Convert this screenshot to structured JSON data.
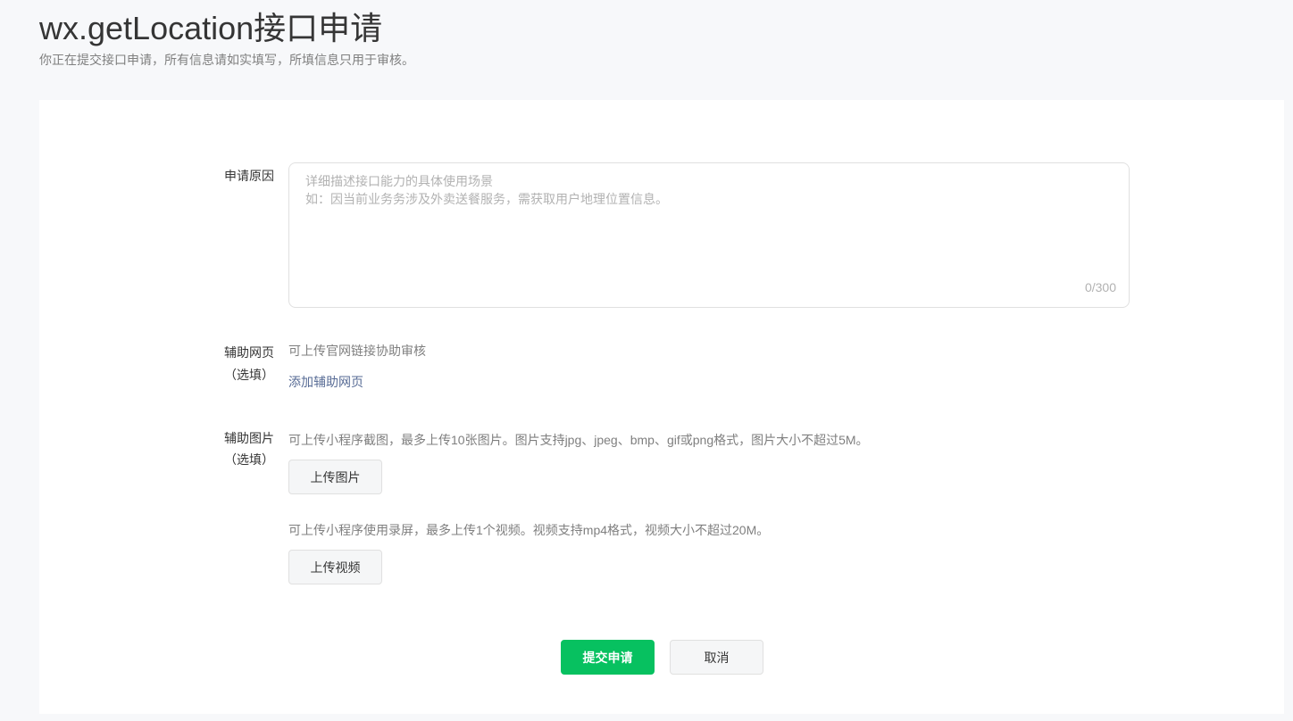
{
  "header": {
    "title": "wx.getLocation接口申请",
    "subtitle": "你正在提交接口申请，所有信息请如实填写，所填信息只用于审核。"
  },
  "form": {
    "reason": {
      "label": "申请原因",
      "placeholder_line1": "详细描述接口能力的具体使用场景",
      "placeholder_line2": "如：因当前业务务涉及外卖送餐服务，需获取用户地理位置信息。",
      "counter": "0/300"
    },
    "webpage": {
      "label": "辅助网页",
      "optional": "（选填）",
      "hint": "可上传官网链接协助审核",
      "add_link": "添加辅助网页"
    },
    "media": {
      "label": "辅助图片",
      "optional": "（选填）",
      "image_hint": "可上传小程序截图，最多上传10张图片。图片支持jpg、jpeg、bmp、gif或png格式，图片大小不超过5M。",
      "upload_image": "上传图片",
      "video_hint": "可上传小程序使用录屏，最多上传1个视频。视频支持mp4格式，视频大小不超过20M。",
      "upload_video": "上传视频"
    }
  },
  "actions": {
    "submit": "提交申请",
    "cancel": "取消"
  },
  "colors": {
    "primary": "#07c160",
    "link": "#576b95"
  }
}
